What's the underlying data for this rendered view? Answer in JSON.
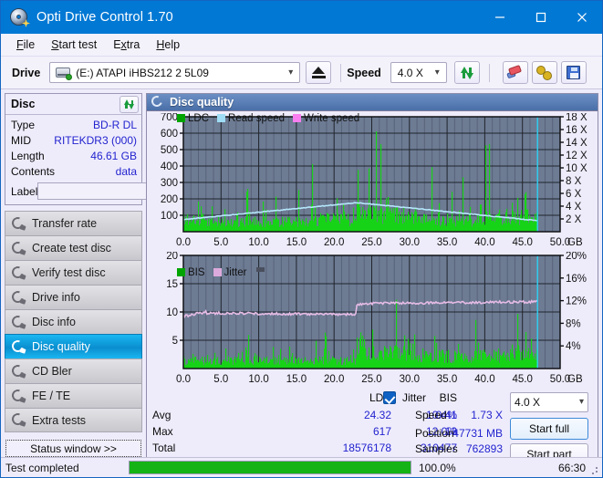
{
  "window": {
    "title": "Opti Drive Control 1.70",
    "app_icon": "disc-icon",
    "minimize": "minimize-icon",
    "maximize": "maximize-icon",
    "close": "close-icon",
    "accent": "#0078d4"
  },
  "menu": {
    "items": [
      {
        "label": "File",
        "mnemonic": "F"
      },
      {
        "label": "Start test",
        "mnemonic": "S"
      },
      {
        "label": "Extra",
        "mnemonic": "x"
      },
      {
        "label": "Help",
        "mnemonic": "H"
      }
    ]
  },
  "toolbar": {
    "drive_label": "Drive",
    "drive_value": "(E:)   ATAPI iHBS212   2 5L09",
    "eject_icon": "eject-icon",
    "speed_label": "Speed",
    "speed_value": "4.0 X",
    "refresh_icon": "refresh-icon",
    "erase_icon": "eraser-icon",
    "settings_icon": "gears-icon",
    "save_icon": "save-icon"
  },
  "disc": {
    "title": "Disc",
    "refresh_icon": "refresh-icon",
    "rows": [
      {
        "key": "Type",
        "value": "BD-R DL"
      },
      {
        "key": "MID",
        "value": "RITEKDR3 (000)"
      },
      {
        "key": "Length",
        "value": "46.61 GB"
      },
      {
        "key": "Contents",
        "value": "data"
      }
    ],
    "label_key": "Label",
    "label_value": "",
    "label_placeholder": "",
    "label_button_icon": "cd-icon"
  },
  "nav": {
    "items": [
      {
        "label": "Transfer rate",
        "icon": "disc-test-icon",
        "active": false
      },
      {
        "label": "Create test disc",
        "icon": "disc-test-icon",
        "active": false
      },
      {
        "label": "Verify test disc",
        "icon": "disc-test-icon",
        "active": false
      },
      {
        "label": "Drive info",
        "icon": "disc-test-icon",
        "active": false
      },
      {
        "label": "Disc info",
        "icon": "disc-test-icon",
        "active": false
      },
      {
        "label": "Disc quality",
        "icon": "disc-test-icon",
        "active": true
      },
      {
        "label": "CD Bler",
        "icon": "disc-test-icon",
        "active": false
      },
      {
        "label": "FE / TE",
        "icon": "disc-test-icon",
        "active": false
      },
      {
        "label": "Extra tests",
        "icon": "disc-test-icon",
        "active": false
      }
    ],
    "status_window_label": "Status window >>"
  },
  "panel": {
    "title": "Disc quality",
    "icon": "disc-quality-icon"
  },
  "chart_data": [
    {
      "type": "line",
      "name": "top-chart",
      "title": "",
      "xlabel": "GB",
      "ylabel": "",
      "xlim": [
        0,
        50
      ],
      "xticks": [
        "0.0",
        "5.0",
        "10.0",
        "15.0",
        "20.0",
        "25.0",
        "30.0",
        "35.0",
        "40.0",
        "45.0",
        "50.0"
      ],
      "xunit": "GB",
      "ylim": [
        0,
        700
      ],
      "yticks": [
        "100",
        "200",
        "300",
        "400",
        "500",
        "600",
        "700"
      ],
      "y2lim": [
        0,
        18
      ],
      "y2ticks": [
        "2 X",
        "4 X",
        "6 X",
        "8 X",
        "10 X",
        "12 X",
        "14 X",
        "16 X",
        "18 X"
      ],
      "grid": true,
      "legend": [
        {
          "name": "LDC",
          "color": "#00a400"
        },
        {
          "name": "Read speed",
          "color": "#9fdcf5"
        },
        {
          "name": "Write speed",
          "color": "#f97ef0"
        }
      ],
      "series": [
        {
          "name": "Read speed",
          "color": "#a8e2f8",
          "description": "rises 1.9X->4.6X over 0-23GB then falls to 1.7X at 47GB"
        },
        {
          "name": "LDC",
          "color": "#00d200",
          "description": "dense green error spikes, baseline ~60-120, peaks to 617"
        }
      ],
      "cursor_gb": 47.0
    },
    {
      "type": "line",
      "name": "bottom-chart",
      "title": "",
      "xlabel": "GB",
      "ylabel": "",
      "xlim": [
        0,
        50
      ],
      "xticks": [
        "0.0",
        "5.0",
        "10.0",
        "15.0",
        "20.0",
        "25.0",
        "30.0",
        "35.0",
        "40.0",
        "45.0",
        "50.0"
      ],
      "xunit": "GB",
      "ylim": [
        0,
        20
      ],
      "yticks": [
        "5",
        "10",
        "15",
        "20"
      ],
      "y2lim": [
        0,
        20
      ],
      "y2ticks": [
        "4%",
        "8%",
        "12%",
        "16%",
        "20%"
      ],
      "grid": true,
      "legend": [
        {
          "name": "BIS",
          "color": "#00a400"
        },
        {
          "name": "Jitter",
          "color": "#ddaadd"
        }
      ],
      "series": [
        {
          "name": "Jitter",
          "color": "#e2b4e2",
          "description": "flat ~9.5-10.0% to 23GB, then ~11.5-12.0% to 47GB"
        },
        {
          "name": "BIS",
          "color": "#00d200",
          "description": "baseline ~2, spikes to 13"
        }
      ],
      "cursor_gb": 47.0
    }
  ],
  "stats": {
    "col_headers": [
      "LDC",
      "BIS"
    ],
    "jitter_header": "Jitter",
    "jitter_checked": true,
    "rows": [
      {
        "label": "Avg",
        "ldc": "24.32",
        "bis": "0.41",
        "jitter": "10.4%"
      },
      {
        "label": "Max",
        "ldc": "617",
        "bis": "13",
        "jitter": "12.0%"
      },
      {
        "label": "Total",
        "ldc": "18576178",
        "bis": "310477",
        "jitter": ""
      }
    ],
    "speed_label": "Speed",
    "speed_value": "1.73 X",
    "position_label": "Position",
    "position_value": "47731 MB",
    "samples_label": "Samples",
    "samples_value": "762893",
    "speed_select": "4.0 X",
    "start_full": "Start full",
    "start_part": "Start part"
  },
  "statusbar": {
    "text": "Test completed",
    "percent_label": "100.0%",
    "percent_value": 100,
    "elapsed": "66:30",
    "bar_color": "#15b315"
  }
}
